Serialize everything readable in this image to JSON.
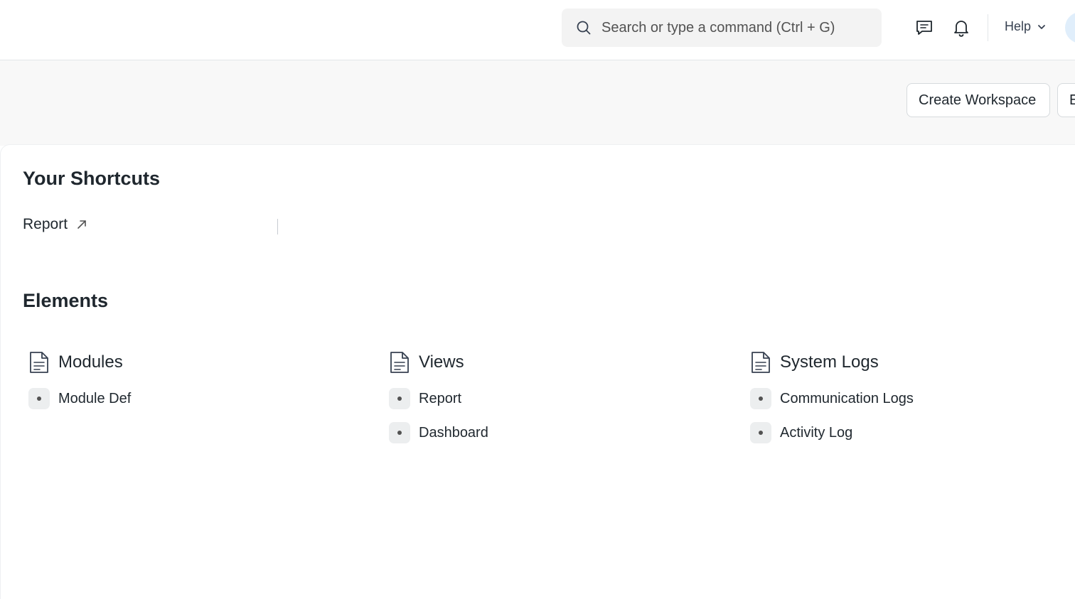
{
  "navbar": {
    "search_placeholder": "Search or type a command (Ctrl + G)",
    "help_label": "Help",
    "icons": [
      "chat-icon",
      "bell-icon",
      "chevron-down-icon",
      "search-icon"
    ]
  },
  "page_head": {
    "create_workspace_label": "Create Workspace",
    "edit_label": "Edit"
  },
  "shortcuts": {
    "title": "Your Shortcuts",
    "items": [
      {
        "label": "Report",
        "icon": "arrow-up-right-icon"
      }
    ]
  },
  "elements": {
    "title": "Elements",
    "columns": [
      {
        "title": "Modules",
        "icon": "document-icon",
        "links": [
          {
            "label": "Module Def"
          }
        ]
      },
      {
        "title": "Views",
        "icon": "document-icon",
        "links": [
          {
            "label": "Report"
          },
          {
            "label": "Dashboard"
          }
        ]
      },
      {
        "title": "System Logs",
        "icon": "document-icon",
        "links": [
          {
            "label": "Communication Logs"
          },
          {
            "label": "Activity Log"
          }
        ]
      }
    ]
  },
  "colors": {
    "page_bg": "#f8f8f8",
    "card_bg": "#ffffff",
    "text": "#1f272e",
    "search_bg": "#f3f3f3"
  }
}
